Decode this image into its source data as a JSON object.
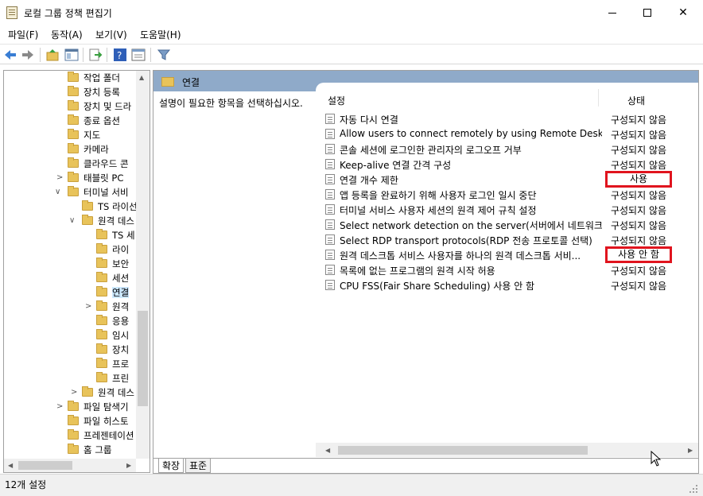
{
  "window": {
    "title": "로컬 그룹 정책 편집기",
    "minimize": "minimize",
    "maximize": "maximize",
    "close": "✕"
  },
  "menu": [
    "파일(F)",
    "동작(A)",
    "보기(V)",
    "도움말(H)"
  ],
  "tree": {
    "items": [
      {
        "label": "작업 폴더"
      },
      {
        "label": "장치 등록"
      },
      {
        "label": "장치 및 드라"
      },
      {
        "label": "종료 옵션"
      },
      {
        "label": "지도"
      },
      {
        "label": "카메라"
      },
      {
        "label": "클라우드 콘"
      },
      {
        "label": "태블릿 PC"
      },
      {
        "label": "터미널 서비"
      },
      {
        "label": "TS 라이선"
      },
      {
        "label": "원격 데스"
      },
      {
        "label": "TS 세"
      },
      {
        "label": "라이"
      },
      {
        "label": "보안"
      },
      {
        "label": "세션"
      },
      {
        "label": "연결"
      },
      {
        "label": "원격"
      },
      {
        "label": "응용"
      },
      {
        "label": "임시"
      },
      {
        "label": "장치"
      },
      {
        "label": "프로"
      },
      {
        "label": "프린"
      },
      {
        "label": "원격 데스"
      },
      {
        "label": "파일 탐색기"
      },
      {
        "label": "파일 히스토"
      },
      {
        "label": "프레젠테이션"
      },
      {
        "label": "홈 그룹"
      }
    ]
  },
  "right": {
    "header_title": "연결",
    "description": "설명이 필요한 항목을 선택하십시오.",
    "col_setting": "설정",
    "col_state": "상태",
    "rows": [
      {
        "name": "자동 다시 연결",
        "state": "구성되지 않음"
      },
      {
        "name": "Allow users to connect remotely by using Remote Desktop...",
        "state": "구성되지 않음"
      },
      {
        "name": "콘솔 세션에 로그인한 관리자의 로그오프 거부",
        "state": "구성되지 않음"
      },
      {
        "name": "Keep-alive 연결 간격 구성",
        "state": "구성되지 않음"
      },
      {
        "name": "연결 개수 제한",
        "state": "사용"
      },
      {
        "name": "앱 등록을 완료하기 위해 사용자 로그인 일시 중단",
        "state": "구성되지 않음"
      },
      {
        "name": "터미널 서비스 사용자 세션의 원격 제어 규칙 설정",
        "state": "구성되지 않음"
      },
      {
        "name": "Select network detection on the server(서버에서 네트워크 ...",
        "state": "구성되지 않음"
      },
      {
        "name": "Select RDP transport protocols(RDP 전송 프로토콜 선택)",
        "state": "구성되지 않음"
      },
      {
        "name": "원격 데스크톱 서비스 사용자를 하나의 원격 데스크톱 서비...",
        "state": "사용 안 함"
      },
      {
        "name": "목록에 없는 프로그램의 원격 시작 허용",
        "state": "구성되지 않음"
      },
      {
        "name": "CPU FSS(Fair Share Scheduling) 사용 안 함",
        "state": "구성되지 않음"
      }
    ],
    "tabs": [
      "확장",
      "표준"
    ]
  },
  "status": {
    "text": "12개 설정"
  },
  "colors": {
    "header_bar": "#8faac9",
    "folder": "#e8c35a",
    "highlight_box": "#e0141e",
    "selection": "#cce8ff"
  }
}
